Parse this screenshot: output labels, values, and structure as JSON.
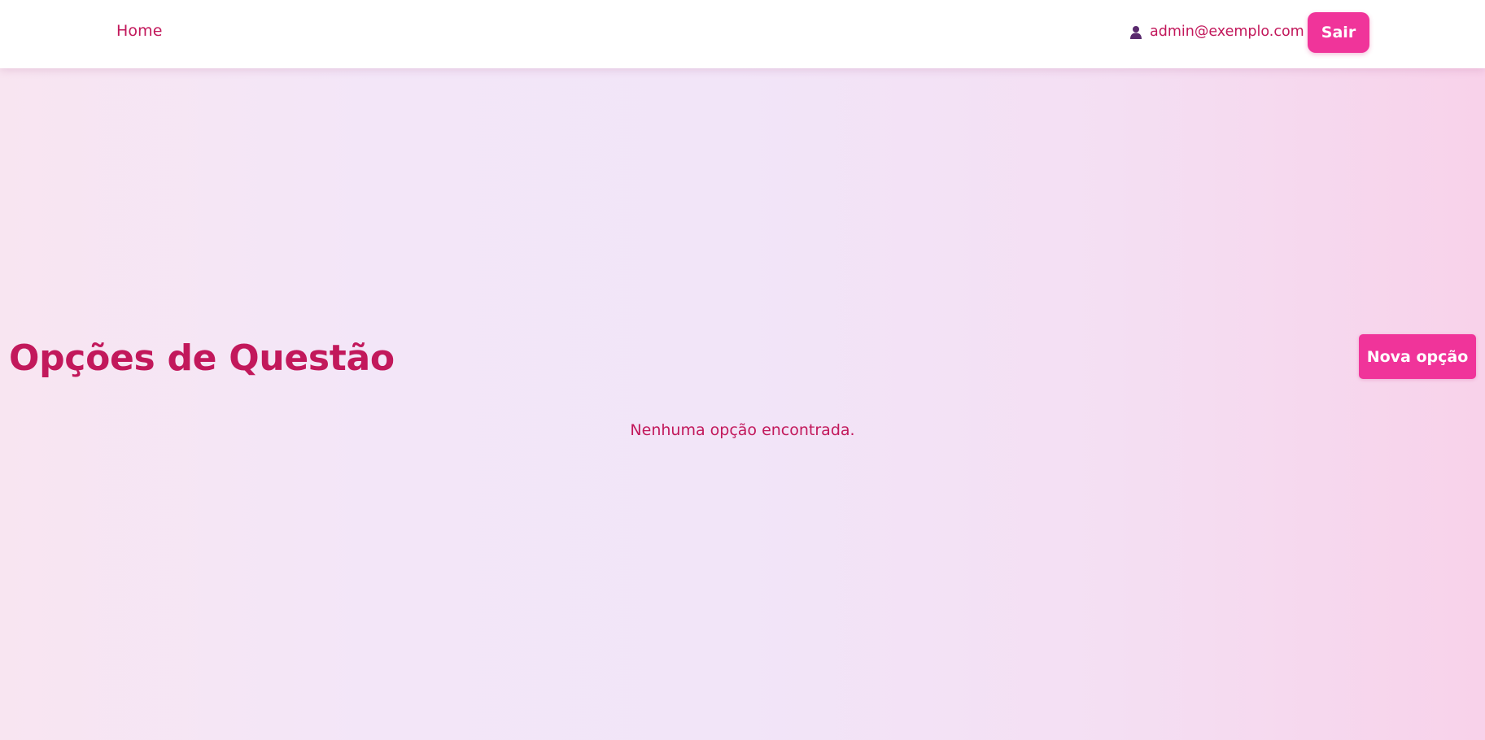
{
  "nav": {
    "home_label": "Home",
    "user_email": "admin@exemplo.com",
    "user_icon": "user-icon",
    "logout_label": "Sair"
  },
  "main": {
    "title": "Opções de Questão",
    "new_button_label": "Nova opção",
    "empty_message": "Nenhuma opção encontrada."
  },
  "colors": {
    "accent": "#f0349a",
    "text_primary": "#c2185b",
    "user_icon": "#5a2a6e"
  }
}
